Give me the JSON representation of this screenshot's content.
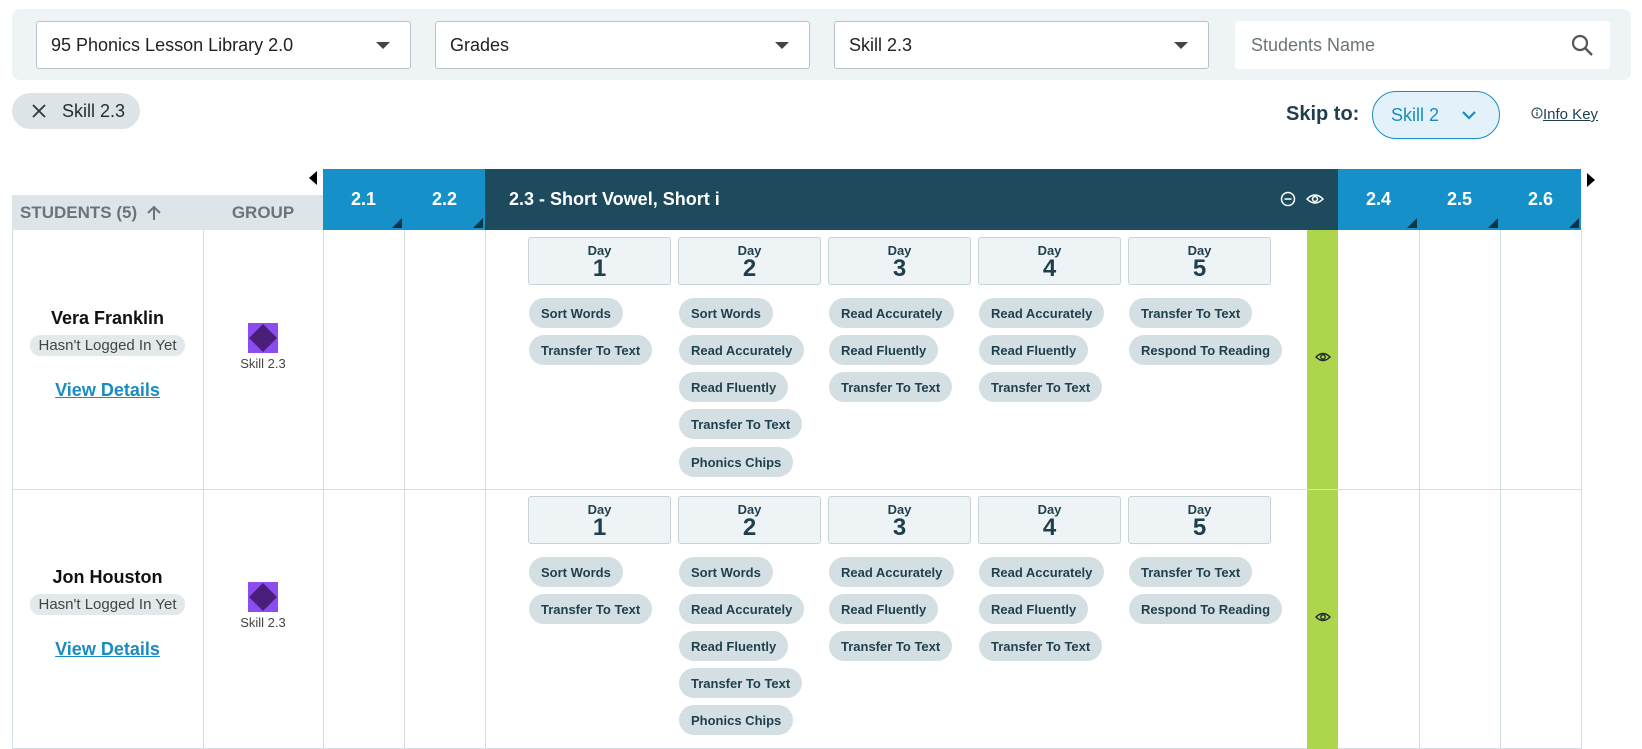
{
  "filters": {
    "library": "95 Phonics Lesson Library 2.0",
    "grades": "Grades",
    "skill": "Skill 2.3",
    "search_placeholder": "Students Name"
  },
  "chip": {
    "label": "Skill 2.3"
  },
  "skip_to": {
    "label": "Skip to:",
    "value": "Skill 2"
  },
  "info_key": {
    "label": "Info Key"
  },
  "table": {
    "students_header": "STUDENTS (5)",
    "group_header": "GROUP",
    "columns_left": [
      "2.1",
      "2.2"
    ],
    "current_skill": "2.3 - Short Vowel, Short i",
    "columns_right": [
      "2.4",
      "2.5",
      "2.6"
    ]
  },
  "day_label": "Day",
  "days": [
    "1",
    "2",
    "3",
    "4",
    "5"
  ],
  "students": [
    {
      "name": "Vera Franklin",
      "status": "Hasn't Logged In Yet",
      "details": "View Details",
      "group": "Skill 2.3",
      "activities": [
        [
          "Sort Words",
          "Transfer To Text"
        ],
        [
          "Sort Words",
          "Read Accurately",
          "Read Fluently",
          "Transfer To Text",
          "Phonics Chips"
        ],
        [
          "Read Accurately",
          "Read Fluently",
          "Transfer To Text"
        ],
        [
          "Read Accurately",
          "Read Fluently",
          "Transfer To Text"
        ],
        [
          "Transfer To Text",
          "Respond To Reading"
        ]
      ]
    },
    {
      "name": "Jon Houston",
      "status": "Hasn't Logged In Yet",
      "details": "View Details",
      "group": "Skill 2.3",
      "activities": [
        [
          "Sort Words",
          "Transfer To Text"
        ],
        [
          "Sort Words",
          "Read Accurately",
          "Read Fluently",
          "Transfer To Text",
          "Phonics Chips"
        ],
        [
          "Read Accurately",
          "Read Fluently",
          "Transfer To Text"
        ],
        [
          "Read Accurately",
          "Read Fluently",
          "Transfer To Text"
        ],
        [
          "Transfer To Text",
          "Respond To Reading"
        ]
      ]
    }
  ],
  "colors": {
    "header_blue": "#1690c8",
    "header_dark": "#1d4a5c",
    "green_bar": "#aed64c",
    "group_icon": "#7b3fe4"
  },
  "icons": [
    "search-icon",
    "close-icon",
    "chevron-down-icon",
    "info-icon",
    "arrow-up-icon",
    "collapse-icon",
    "eye-icon",
    "group-diamond-icon"
  ]
}
